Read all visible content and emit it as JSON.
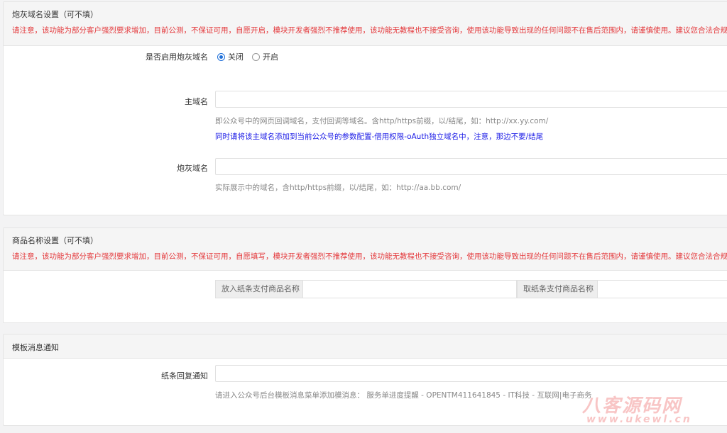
{
  "section1": {
    "title": "炮灰域名设置（可不填）",
    "warning": "请注意，该功能为部分客户强烈要求增加，目前公测，不保证可用，自愿开启，模块开发者强烈不推荐使用，该功能无教程也不接受咨询，使用该功能导致出现的任何问题不在售后范围内，请谨慎使用。建议您合法合规经营",
    "enable": {
      "label": "是否启用炮灰域名",
      "options": [
        "关闭",
        "开启"
      ],
      "selected": "关闭"
    },
    "main_domain": {
      "label": "主域名",
      "value": "",
      "help": "即公众号中的网页回调域名，支付回调等域名。含http/https前缀，以/结尾，如：http://xx.yy.com/",
      "note": "同时请将该主域名添加到当前公众号的参数配置-借用权限-oAuth独立域名中，注意，那边不要/结尾"
    },
    "cannon_domain": {
      "label": "炮灰域名",
      "value": "",
      "help": "实际展示中的域名，含http/https前缀，以/结尾，如：http://aa.bb.com/"
    }
  },
  "section2": {
    "title": "商品名称设置（可不填）",
    "warning": "请注意，该功能为部分客户强烈要求增加，目前公测，不保证可用，自愿填写，模块开发者强烈不推荐使用，该功能无教程也不接受咨询，使用该功能导致出现的任何问题不在售后范围内，请谨慎使用。建议您合法合规经营",
    "put_label": "放入纸条支付商品名称",
    "put_value": "",
    "take_label": "取纸条支付商品名称",
    "take_value": ""
  },
  "section3": {
    "title": "模板消息通知",
    "reply": {
      "label": "纸条回复通知",
      "value": "",
      "help": "请进入公众号后台模板消息菜单添加模消息：  服务单进度提醒 - OPENTM411641845 - IT科技 - 互联网|电子商务"
    }
  },
  "watermark": {
    "text": "八客源码网",
    "sub": "www.ukewl.cn"
  },
  "colors": {
    "warning": "#e4393c",
    "note": "#1a1ae6",
    "radio_accent": "#1e6fd9"
  }
}
